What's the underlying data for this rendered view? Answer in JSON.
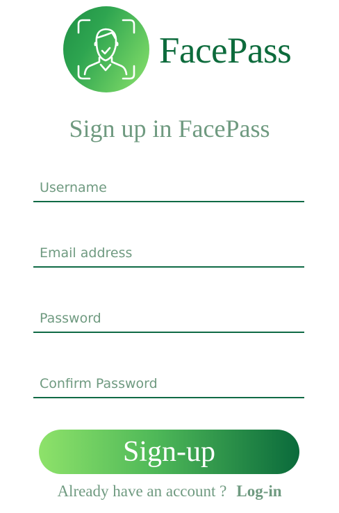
{
  "brand": {
    "name": "FacePass",
    "logo_icon": "face-scan-icon",
    "colors": {
      "dark_green": "#0d6b3c",
      "light_green": "#8ee26a",
      "muted_green_text": "#6f9a80"
    }
  },
  "page_title": "Sign up in FacePass",
  "form": {
    "username": {
      "placeholder": "Username",
      "value": ""
    },
    "email": {
      "placeholder": "Email address",
      "value": ""
    },
    "password": {
      "placeholder": "Password",
      "value": ""
    },
    "confirm_password": {
      "placeholder": "Confirm Password",
      "value": ""
    }
  },
  "signup_button_label": "Sign-up",
  "footer": {
    "prompt": "Already have an account ?",
    "login_link": "Log-in"
  }
}
